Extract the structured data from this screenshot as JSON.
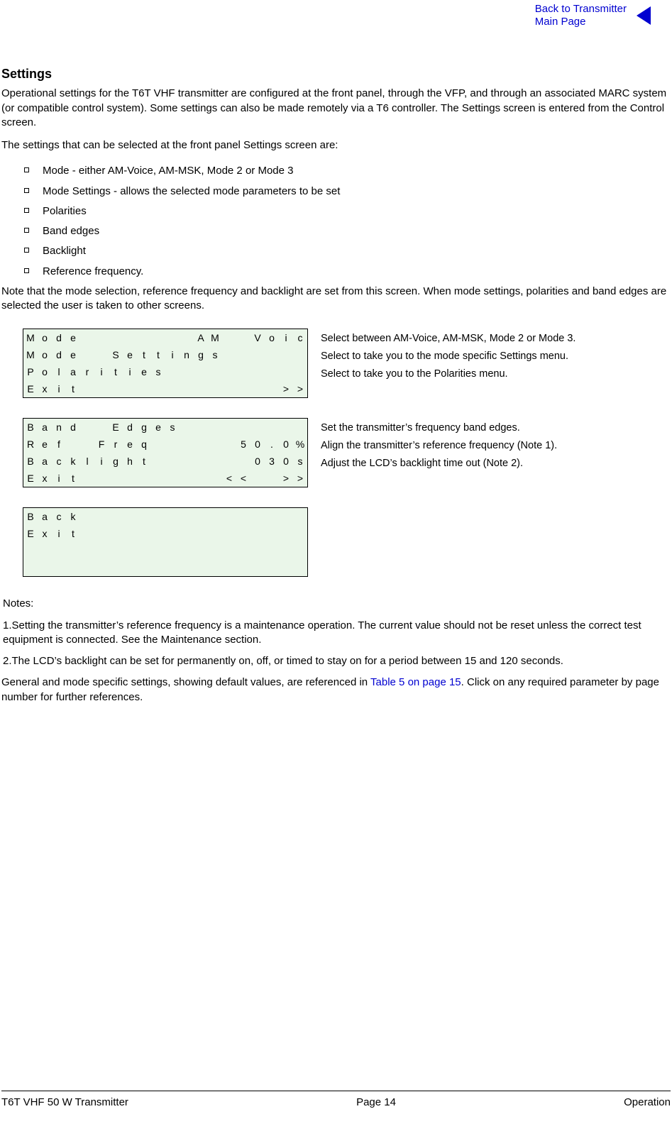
{
  "nav": {
    "back_line1": "Back to Transmitter",
    "back_line2": "Main Page"
  },
  "title": "Settings",
  "intro1": "Operational settings for the T6T VHF transmitter are configured at the front panel, through the VFP, and through an associated MARC system (or compatible control system). Some settings can also be made remotely via a T6 controller. The Settings screen is entered from the Control screen.",
  "intro2": "The settings that can be selected at the front panel Settings screen are:",
  "bullets": {
    "b1": "Mode - either AM-Voice, AM-MSK, Mode 2 or Mode 3",
    "b2": "Mode Settings - allows the selected mode parameters to be set",
    "b3": "Polarities",
    "b4": "Band edges",
    "b5": "Backlight",
    "b6": "Reference frequency."
  },
  "note_after_bullets": "Note that the mode selection, reference frequency and backlight are set from this screen. When mode settings, polarities and band edges are selected the user is taken to other screens.",
  "lcd1": {
    "r1": "Mode        AM  Voice",
    "r2": "Mode  Settings      ",
    "r3": "Polarities          ",
    "r4": "Exit              >>",
    "labels": {
      "l1": "Select between AM-Voice, AM-MSK, Mode 2 or Mode 3.",
      "l2": "Select to take you to the mode specific Settings menu.",
      "l3": "Select to take you to the Polarities menu."
    }
  },
  "lcd2": {
    "r1": "Band  Edges         ",
    "r2": "Ref  Freq      50.0%",
    "r3": "Backlight       030s",
    "r4": "Exit          <<  >>",
    "labels": {
      "l1": "Set the transmitter’s frequency band edges.",
      "l2": "Align the transmitter’s reference frequency (Note 1).",
      "l3": "Adjust the LCD’s backlight time out (Note 2)."
    }
  },
  "lcd3": {
    "r1": "Back                ",
    "r2": "Exit                ",
    "r3": "                    ",
    "r4": "                    "
  },
  "notes": {
    "heading": "Notes:",
    "n1": "1.Setting the transmitter’s reference frequency is a maintenance operation. The current value should not be reset unless the correct test equipment is connected. See the Maintenance section.",
    "n2": "2.The LCD’s backlight can be set for permanently on, off, or timed to stay on for a period between 15 and 120 seconds."
  },
  "outro_pre": "General and mode specific settings, showing default values, are referenced in ",
  "outro_link": "Table 5 on page 15",
  "outro_post": ". Click on any required parameter by page number for further references.",
  "footer": {
    "left": "T6T VHF 50 W Transmitter",
    "center": "Page 14",
    "right": "Operation"
  }
}
